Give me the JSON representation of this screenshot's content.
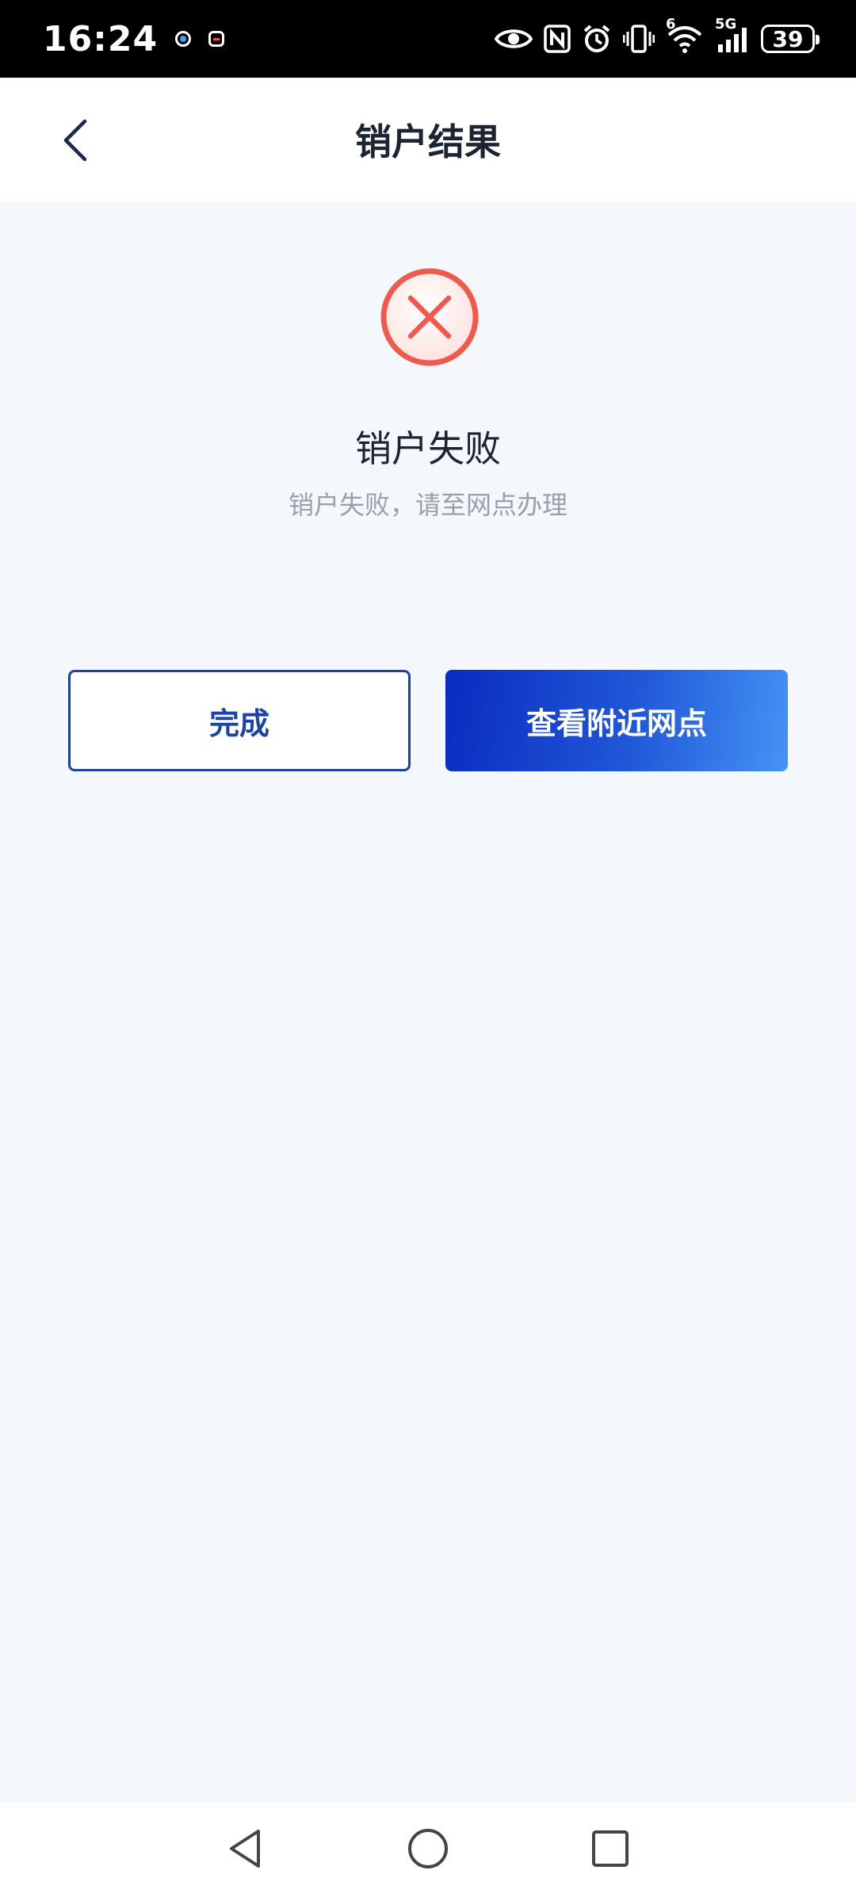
{
  "status_bar": {
    "time": "16:24",
    "battery": "39",
    "network_label": "5G",
    "wifi_label": "6"
  },
  "header": {
    "title": "销户结果"
  },
  "result": {
    "status_icon": "error-circle-x-icon",
    "title": "销户失败",
    "subtitle": "销户失败，请至网点办理"
  },
  "actions": {
    "done_label": "完成",
    "nearby_label": "查看附近网点"
  },
  "colors": {
    "primary": "#1b43a3",
    "gradient_start": "#0a2bbf",
    "gradient_end": "#4593f5",
    "error": "#ef5a4c",
    "background": "#f4f7fb"
  }
}
